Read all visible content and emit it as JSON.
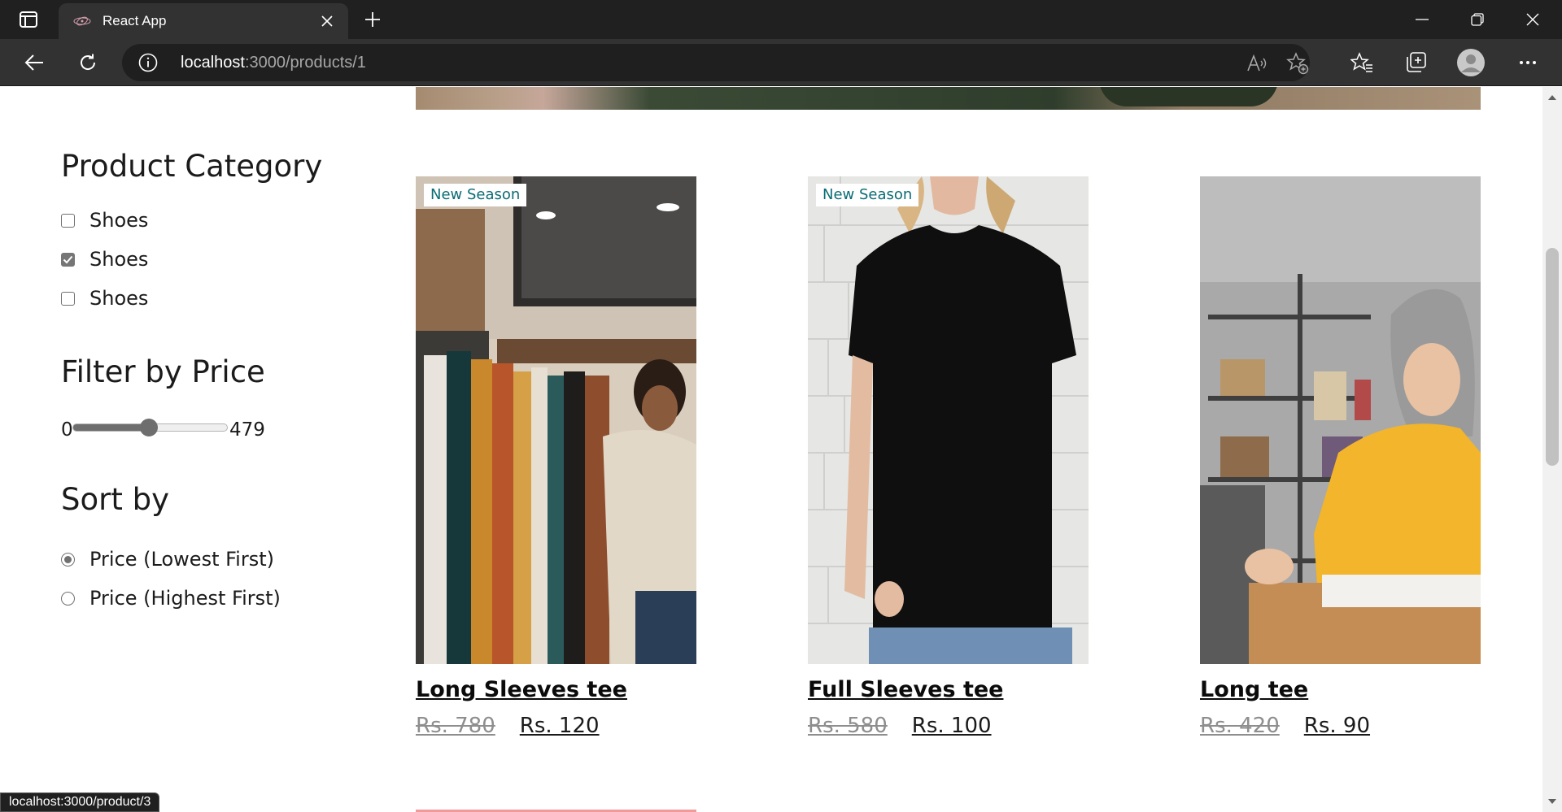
{
  "browser": {
    "tab_title": "React App",
    "url_host": "localhost",
    "url_rest": ":3000/products/1",
    "status_url": "localhost:3000/product/3",
    "icons": {
      "tab_actions": "tab-actions-icon",
      "favicon": "react-favicon",
      "close": "close-icon",
      "new_tab": "plus-icon",
      "back": "back-arrow-icon",
      "refresh": "refresh-icon",
      "info": "info-icon",
      "read_aloud": "read-aloud-icon",
      "add_favorite": "add-favorite-icon",
      "favorites": "favorites-icon",
      "collections": "collections-icon",
      "profile": "profile-icon",
      "menu": "more-icon"
    }
  },
  "sidebar": {
    "category_heading": "Product Category",
    "categories": [
      {
        "label": "Shoes",
        "checked": false
      },
      {
        "label": "Shoes",
        "checked": true
      },
      {
        "label": "Shoes",
        "checked": false
      }
    ],
    "price_heading": "Filter by Price",
    "price_min": "0",
    "price_max": "479",
    "price_slider_fraction": 0.49,
    "sort_heading": "Sort by",
    "sort_options": [
      {
        "label": "Price (Lowest First)",
        "selected": true
      },
      {
        "label": "Price (Highest First)",
        "selected": false
      }
    ]
  },
  "products": [
    {
      "badge": "New Season",
      "title": "Long Sleeves tee",
      "old_price": "Rs. 780",
      "new_price": "Rs. 120"
    },
    {
      "badge": "New Season",
      "title": "Full Sleeves tee",
      "old_price": "Rs. 580",
      "new_price": "Rs. 100"
    },
    {
      "badge": "",
      "title": "Long tee",
      "old_price": "Rs. 420",
      "new_price": "Rs. 90"
    }
  ],
  "colors": {
    "badge_text": "#0a6c75",
    "chrome_dark": "#202020",
    "chrome_toolbar": "#323232"
  }
}
